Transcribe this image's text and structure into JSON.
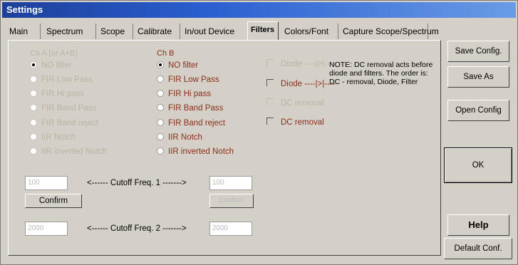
{
  "window": {
    "title": "Settings"
  },
  "tabs": [
    {
      "label": "Main"
    },
    {
      "label": "Spectrum"
    },
    {
      "label": "Scope"
    },
    {
      "label": "Calibrate"
    },
    {
      "label": "In/out Device"
    },
    {
      "label": "Filters"
    },
    {
      "label": "Colors/Font"
    },
    {
      "label": "Capture Scope/Spectrum"
    }
  ],
  "ch_a": {
    "label": "Ch A (or A+B)",
    "options": [
      "NO filter",
      "FIR Low Pass",
      "FIR Hi pass",
      "FIR Band Pass",
      "FIR Band reject",
      "IIR Notch",
      "IIR inverted Notch"
    ],
    "selected": 0
  },
  "ch_b": {
    "label": "Ch B",
    "options": [
      "NO filter",
      "FIR Low Pass",
      "FIR Hi pass",
      "FIR Band Pass",
      "FIR Band reject",
      "IIR Notch",
      "IIR inverted Notch"
    ],
    "selected": 0
  },
  "checks": [
    "Diode ----|>|----",
    "Diode ----|>|----",
    "DC removal",
    "DC removal"
  ],
  "note": "NOTE: DC removal acts before diode and filters. The order is: DC - removal, Diode, Filter",
  "cutoff1": {
    "label": "<------ Cutoff Freq. 1 ------->",
    "left_value": "100",
    "right_value": "100"
  },
  "cutoff2": {
    "label": "<------ Cutoff Freq. 2 ------->",
    "left_value": "2000",
    "right_value": "2000"
  },
  "confirm_left": "Confirm",
  "confirm_right": "Confirm",
  "side_buttons": {
    "save_config": "Save Config.",
    "save_as": "Save As",
    "open_config": "Open Config",
    "ok": "OK",
    "help": "Help",
    "default_conf": "Default Conf."
  }
}
